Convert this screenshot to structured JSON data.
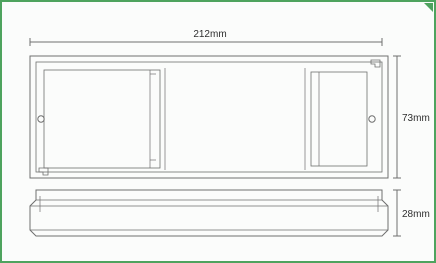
{
  "figure": {
    "width_label": "212mm",
    "height_label": "73mm",
    "depth_label": "28mm"
  },
  "colors": {
    "frame_border": "#4ea35e",
    "line": "#6f6f6f",
    "text": "#2f2f2f"
  }
}
